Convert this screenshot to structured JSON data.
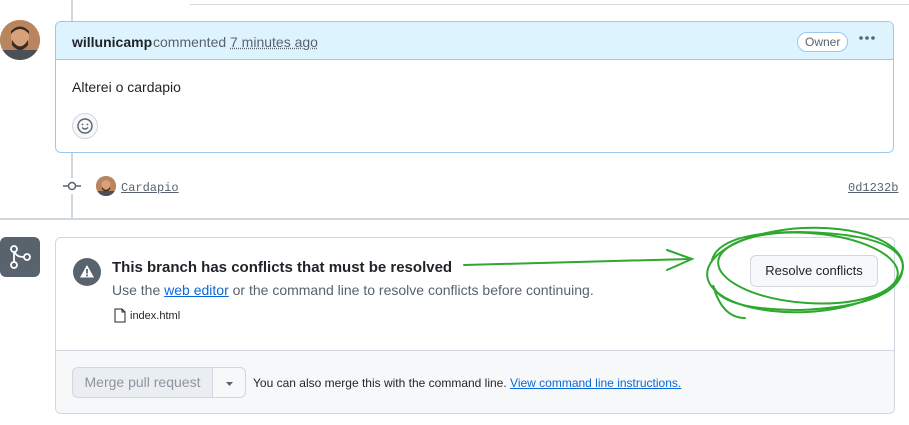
{
  "comment": {
    "author": "willunicamp",
    "action": "commented",
    "time": "7 minutes ago",
    "badge": "Owner",
    "more_icon": "kebab-horizontal-icon",
    "body": "Alterei o cardapio",
    "reaction_icon": "smiley-icon"
  },
  "commit": {
    "message": "Cardapio",
    "sha": "0d1232b",
    "icon": "git-commit-icon"
  },
  "conflicts": {
    "branch_icon": "git-branch-icon",
    "warning_icon": "alert-icon",
    "title": "This branch has conflicts that must be resolved",
    "desc_prefix": "Use the ",
    "desc_link": "web editor",
    "desc_suffix": " or the command line to resolve conflicts before continuing.",
    "files": [
      "index.html"
    ],
    "resolve_button": "Resolve conflicts"
  },
  "merge": {
    "button": "Merge pull request",
    "caret_icon": "triangle-down-icon",
    "hint_prefix": "You can also merge this with the command line. ",
    "hint_link": "View command line instructions."
  },
  "annotation_color": "#2ea82e"
}
